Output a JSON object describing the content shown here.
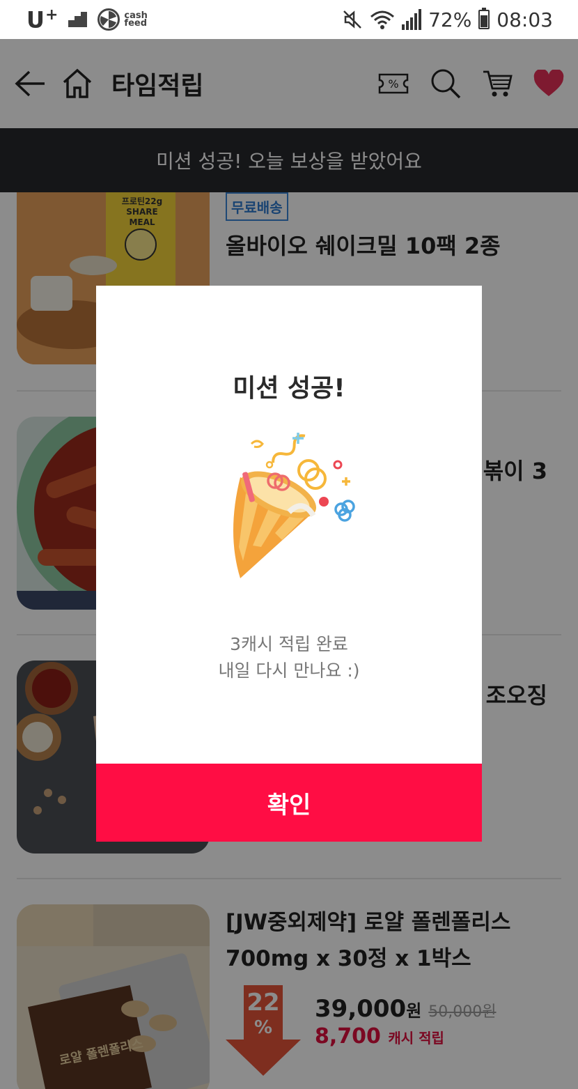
{
  "status_bar": {
    "carrier": "U",
    "carrier_plus": "+",
    "app_logo_line1": "cash",
    "app_logo_line2": "feed",
    "battery_percent": "72%",
    "time": "08:03"
  },
  "header": {
    "title": "타임적립"
  },
  "banner": {
    "text": "미션 성공! 오늘 보상을 받았어요"
  },
  "products": [
    {
      "tag": "무료배송",
      "name": "올바이오 쉐이크밀 10팩 2종",
      "thumb_lines": [
        "프로틴22g",
        "SHARE",
        "MEAL"
      ]
    },
    {
      "name_visible_fragment": "볶이 3"
    },
    {
      "name_visible_fragment": "조오징"
    },
    {
      "name_line1": "[JW중외제약] 로얄 폴렌폴리스",
      "name_line2": "700mg x 30정 x 1박스",
      "discount_value": "22",
      "discount_unit": "%",
      "price": "39,000",
      "price_unit": "원",
      "original_price": "50,000원",
      "cash_amount": "8,700",
      "cash_label": "캐시 적립",
      "thumb_text": "로얄 폴렌폴리스"
    }
  ],
  "modal": {
    "title": "미션 성공!",
    "message_line1": "3캐시 적립 완료",
    "message_line2": "내일 다시 만나요 :)",
    "confirm_label": "확인"
  },
  "colors": {
    "confirm_button": "#ff0d44",
    "banner_bg": "#27282c",
    "cash_text": "#e0103f",
    "free_shipping_tag": "#2f7bd0",
    "heart_icon": "#e53158"
  }
}
